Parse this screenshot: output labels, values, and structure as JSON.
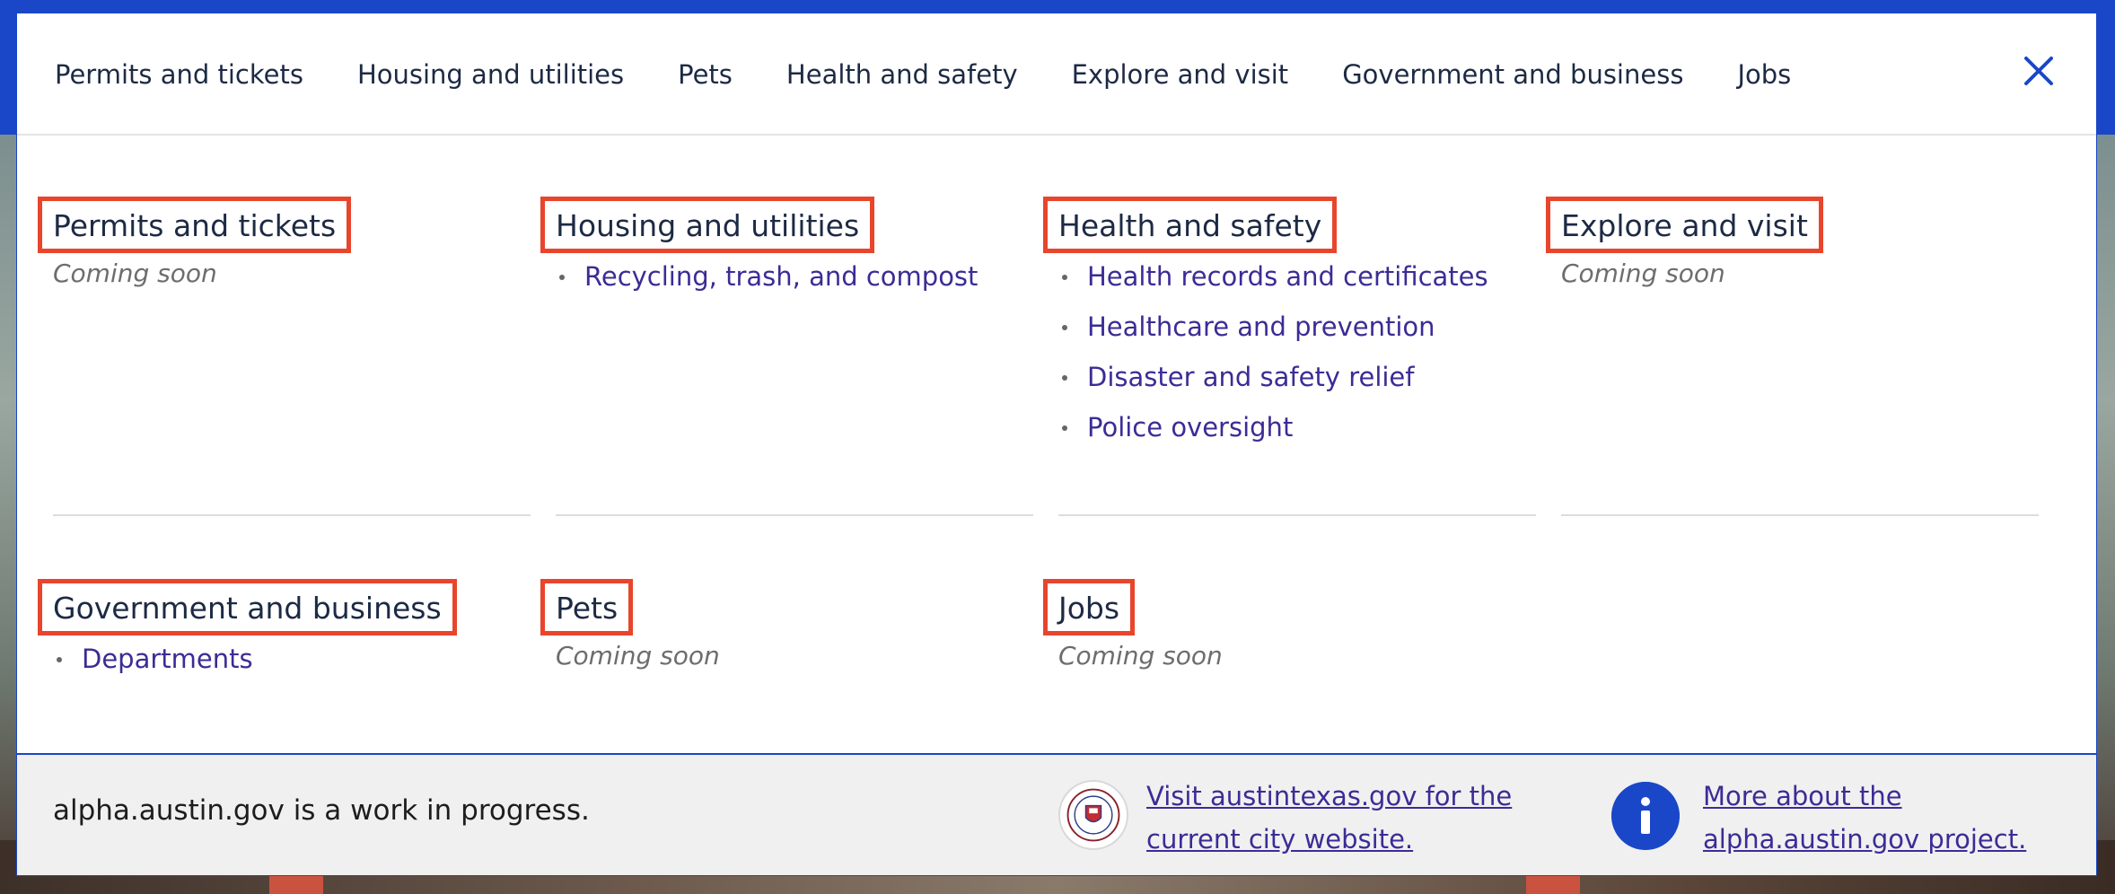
{
  "nav": {
    "items": [
      "Permits and tickets",
      "Housing and utilities",
      "Pets",
      "Health and safety",
      "Explore and visit",
      "Government and business",
      "Jobs"
    ]
  },
  "sections": {
    "permits": {
      "title": "Permits and tickets",
      "status": "Coming soon"
    },
    "housing": {
      "title": "Housing and utilities",
      "links": [
        "Recycling, trash, and compost"
      ]
    },
    "health": {
      "title": "Health and safety",
      "links": [
        "Health records and certificates",
        "Healthcare and prevention",
        "Disaster and safety relief",
        "Police oversight"
      ]
    },
    "explore": {
      "title": "Explore and visit",
      "status": "Coming soon"
    },
    "government": {
      "title": "Government and business",
      "links": [
        "Departments"
      ]
    },
    "pets": {
      "title": "Pets",
      "status": "Coming soon"
    },
    "jobs": {
      "title": "Jobs",
      "status": "Coming soon"
    }
  },
  "footer": {
    "wip_text": "alpha.austin.gov is a work in progress.",
    "current_site_link": "Visit austintexas.gov for the current city website.",
    "about_link": "More about the alpha.austin.gov project."
  },
  "icons": {
    "close": "close-icon",
    "info": "info-icon",
    "seal": "city-seal-icon"
  },
  "colors": {
    "brand_blue": "#1a47c8",
    "link_purple": "#3b2c96",
    "highlight_red": "#e8452c"
  }
}
